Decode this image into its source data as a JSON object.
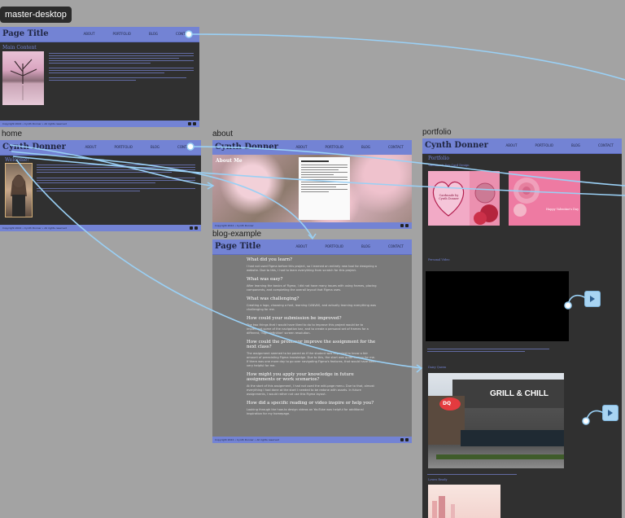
{
  "canvas_pill": "master-desktop",
  "frame_labels": {
    "home": "home",
    "about": "about",
    "portfolio": "portfolio",
    "blog": "blog-example"
  },
  "nav_links": [
    "ABOUT",
    "PORTFOLIO",
    "BLOG",
    "CONTACT"
  ],
  "master": {
    "title": "Page Title",
    "heading": "Main Content",
    "footer": "Copyright 2024 • Cynth Donner • All rights reserved"
  },
  "home": {
    "title": "Cynth Donner",
    "heading": "Welcome!",
    "footer": "Copyright 2024 • Cynth Donner • All rights reserved"
  },
  "about": {
    "title": "Cynth Donner",
    "heading": "About Me",
    "footer": "Copyright 2024 • Cynth Donner"
  },
  "portfolio": {
    "title": "Cynth Donner",
    "heading": "Portfolio",
    "sub1": "Valentine's Day Card Design",
    "sub2": "Personal Video",
    "sub3": "Dairy Queen",
    "sub4": "Lowes Ready",
    "card_text": "Happy Valentine's Day",
    "card_left": "Cardmade by Cynth Donner",
    "dq_sign": "GRILL & CHILL",
    "dq_logo": "DQ"
  },
  "blog": {
    "title": "Page Title",
    "items": [
      {
        "q": "What did you learn?",
        "a": "I had not used Figma before this project, so I learned an entirely new tool for designing a website. Due to this, I had to learn everything from scratch for this project."
      },
      {
        "q": "What was easy?",
        "a": "After learning the basics of Figma, I did not have many issues with using frames, placing components, and completing the overall layout that Figma uses."
      },
      {
        "q": "What was challenging?",
        "a": "Creating a logo, choosing a font, learning CANVAS, and actually learning everything was challenging for me."
      },
      {
        "q": "How could your submission be improved?",
        "a": "The two things that I would have liked to do to improve this project would be to implement some of the navigation bar, and to create a personal set of frames for a different, 'high definition' screen resolution."
      },
      {
        "q": "How could the professor improve the assignment for the next class?",
        "a": "The assignment seemed to be paced as if the student was expected to know a fair amount of preexisting Figma knowledge. Due to this, the start was quite bumpy for me. If there was one more day to go over navigating Figma's features, that would have been very helpful for me."
      },
      {
        "q": "How might you apply your knowledge in future assignments or work scenarios?",
        "a": "At the start of this assignment, I had not used the wiki-page menu. Due to that, almost everything I had done at the start I needed to be redone with assets. In future assignments, I would rather not use this Figma layout."
      },
      {
        "q": "How did a specific reading or video inspire or help you?",
        "a": "Looking through the how-to design videos on YouTube was helpful for additional inspiration for my homepage."
      }
    ],
    "footer": "Copyright 2024 • Cynth Donner • All rights reserved"
  }
}
